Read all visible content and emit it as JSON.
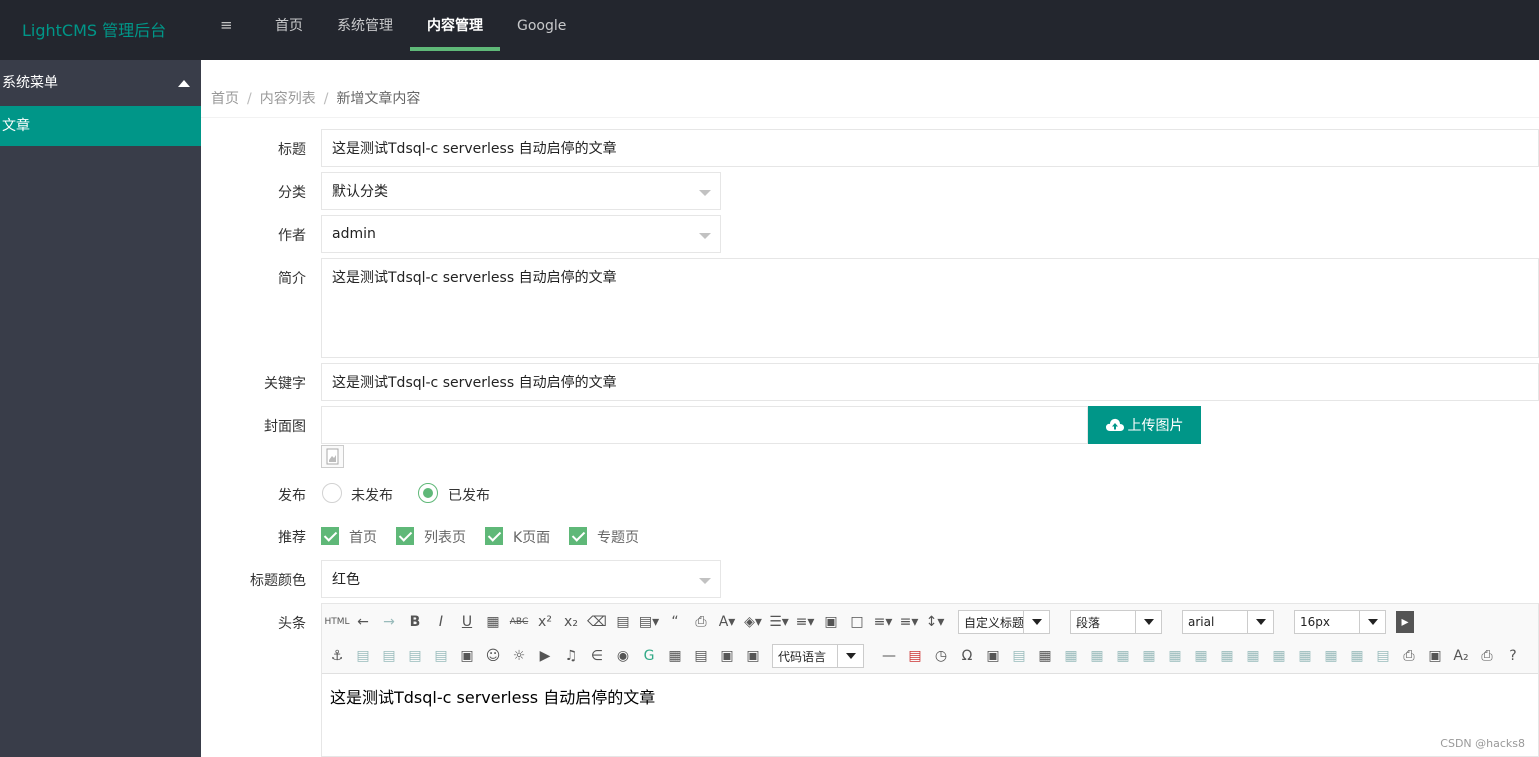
{
  "header": {
    "logo": "LightCMS 管理后台",
    "nav": [
      "首页",
      "系统管理",
      "内容管理",
      "Google"
    ],
    "active_nav": "内容管理"
  },
  "sidebar": {
    "title": "系统菜单",
    "items": [
      "文章"
    ]
  },
  "breadcrumb": [
    "首页",
    "内容列表",
    "新增文章内容"
  ],
  "form": {
    "title_label": "标题",
    "title_value": "这是测试Tdsql-c serverless 自动启停的文章",
    "category_label": "分类",
    "category_value": "默认分类",
    "author_label": "作者",
    "author_value": "admin",
    "summary_label": "简介",
    "summary_value": "这是测试Tdsql-c serverless 自动启停的文章",
    "keywords_label": "关键字",
    "keywords_value": "这是测试Tdsql-c serverless 自动启停的文章",
    "cover_label": "封面图",
    "cover_value": "",
    "upload_label": "上传图片",
    "publish_label": "发布",
    "publish_options": [
      "未发布",
      "已发布"
    ],
    "publish_selected": "已发布",
    "recommend_label": "推荐",
    "recommend_options": [
      "首页",
      "列表页",
      "K页面",
      "专题页"
    ],
    "title_color_label": "标题颜色",
    "title_color_value": "红色",
    "headline_label": "头条"
  },
  "editor": {
    "custom_title": "自定义标题",
    "paragraph": "段落",
    "font_family": "arial",
    "font_size": "16px",
    "code_language": "代码语言",
    "html_btn": "HTML",
    "content": "这是测试Tdsql-c serverless 自动启停的文章"
  },
  "watermark": "CSDN @hacks8",
  "colors": {
    "accent": "#009688",
    "green": "#5fb878",
    "topbar": "#23262e",
    "sidebar": "#393d49"
  }
}
